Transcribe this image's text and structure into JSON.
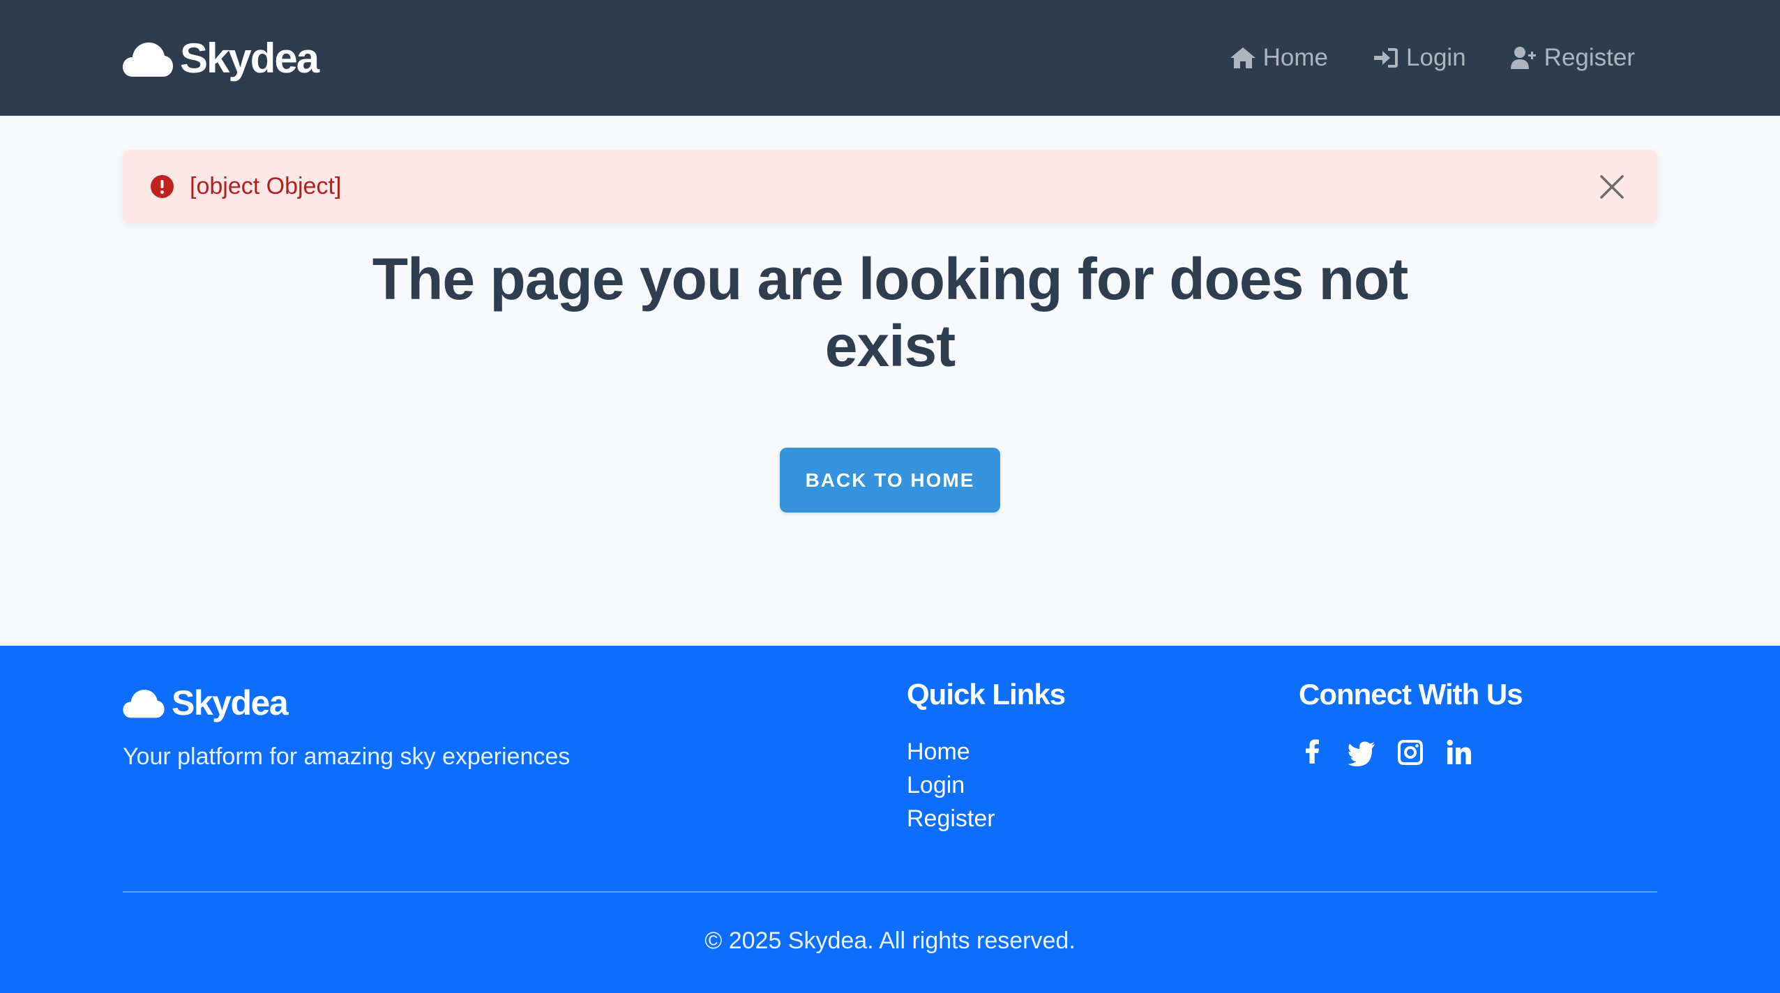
{
  "header": {
    "brand": "Skydea",
    "nav": [
      {
        "label": "Home",
        "icon": "home-icon"
      },
      {
        "label": "Login",
        "icon": "sign-in-icon"
      },
      {
        "label": "Register",
        "icon": "user-plus-icon"
      }
    ]
  },
  "alert": {
    "message": "[object Object]",
    "icon": "exclamation-circle-icon",
    "close_icon": "close-icon"
  },
  "main": {
    "title": "The page you are looking for does not exist",
    "button_label": "BACK TO HOME"
  },
  "footer": {
    "brand": "Skydea",
    "tagline": "Your platform for amazing sky experiences",
    "quick_links_title": "Quick Links",
    "quick_links": [
      "Home",
      "Login",
      "Register"
    ],
    "connect_title": "Connect With Us",
    "socials": [
      "facebook-icon",
      "twitter-icon",
      "instagram-icon",
      "linkedin-icon"
    ],
    "copyright": "© 2025 Skydea. All rights reserved."
  },
  "colors": {
    "header_bg": "#2e3c50",
    "page_bg": "#f7f9fb",
    "alert_bg": "#fde8e7",
    "alert_text": "#b0211c",
    "button_bg": "#3592dc",
    "footer_bg": "#0d6efd"
  }
}
